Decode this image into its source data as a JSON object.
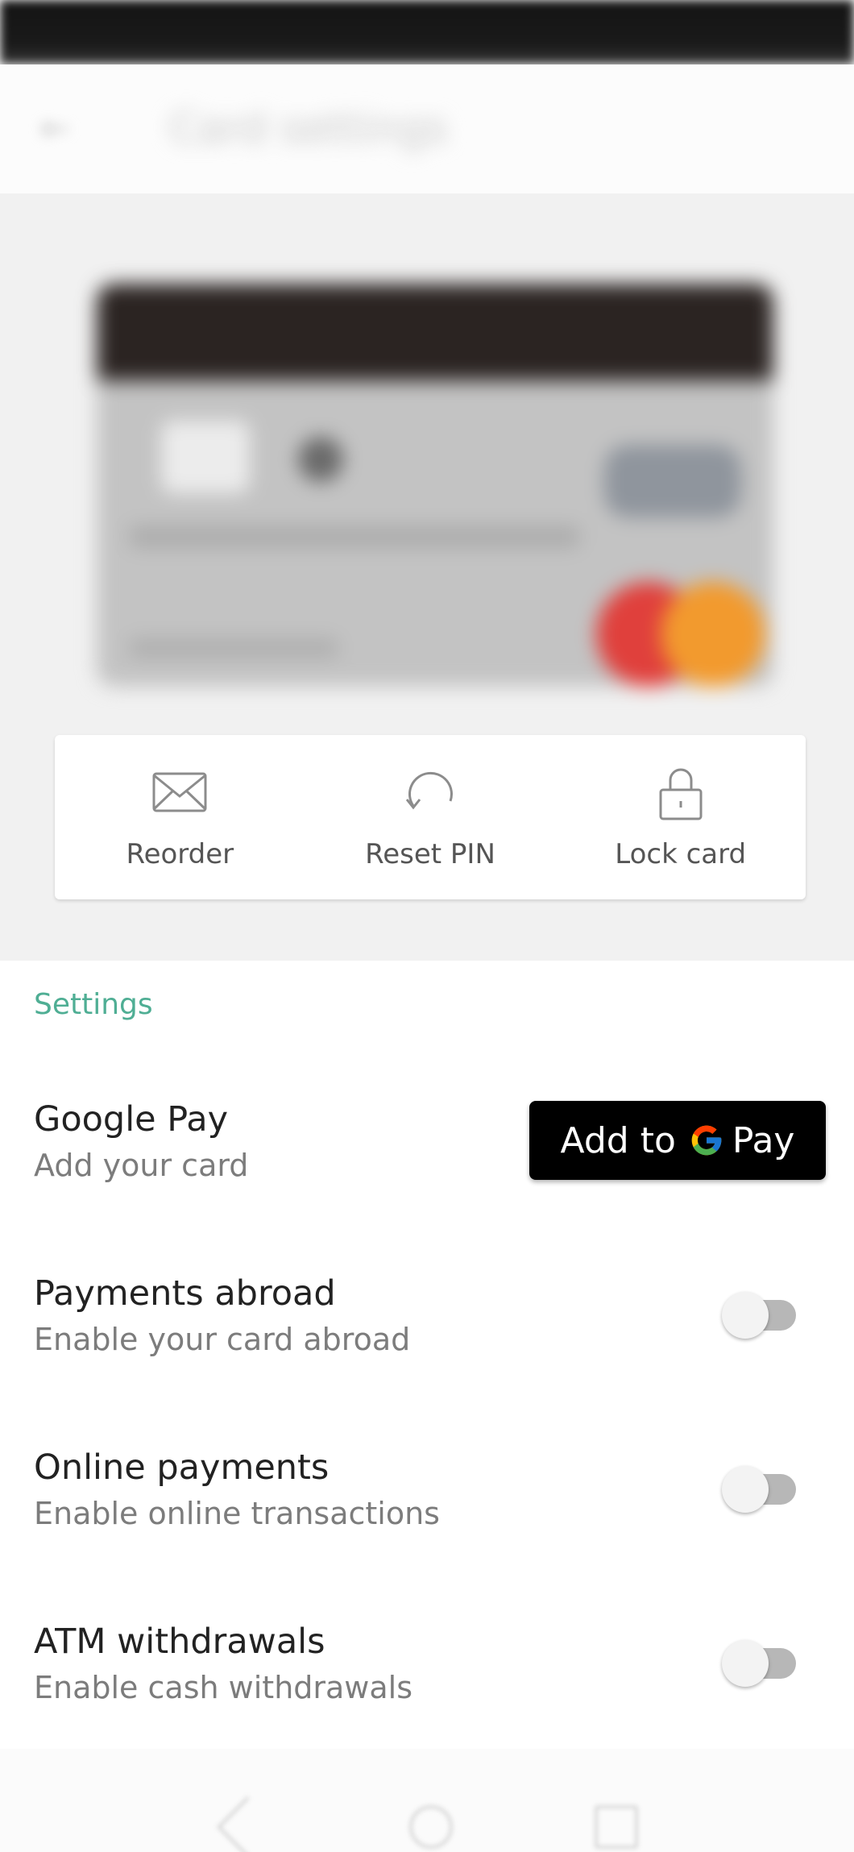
{
  "header": {
    "title": "Card settings"
  },
  "actions": [
    {
      "label": "Reorder",
      "icon": "envelope-icon"
    },
    {
      "label": "Reset PIN",
      "icon": "refresh-icon"
    },
    {
      "label": "Lock card",
      "icon": "lock-icon"
    }
  ],
  "settings": {
    "heading": "Settings",
    "google_pay": {
      "title": "Google Pay",
      "subtitle": "Add your card",
      "button_prefix": "Add to",
      "button_suffix": "Pay"
    },
    "payments_abroad": {
      "title": "Payments abroad",
      "subtitle": "Enable your card abroad",
      "enabled": false
    },
    "online_payments": {
      "title": "Online payments",
      "subtitle": "Enable online transactions",
      "enabled": false
    },
    "atm_withdrawals": {
      "title": "ATM withdrawals",
      "subtitle": "Enable cash withdrawals",
      "enabled": false
    }
  },
  "colors": {
    "accent": "#4fae94",
    "gpay_button": "#000000"
  }
}
